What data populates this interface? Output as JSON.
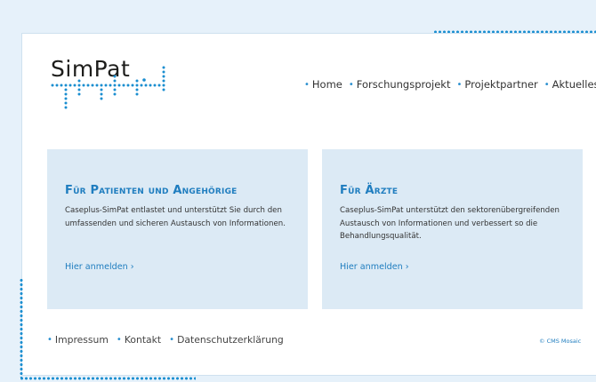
{
  "logo": {
    "text": "SimPat"
  },
  "nav": {
    "items": [
      {
        "label": "Home"
      },
      {
        "label": "Forschungsprojekt"
      },
      {
        "label": "Projektpartner"
      },
      {
        "label": "Aktuelles"
      }
    ]
  },
  "cards": {
    "patients": {
      "title": "Für Patienten und Angehörige",
      "text": "Caseplus-SimPat entlastet und unterstützt Sie durch den umfassenden und sicheren Austausch von Informationen.",
      "link": "Hier anmelden ›"
    },
    "doctors": {
      "title": "Für Ärzte",
      "text": "Caseplus-SimPat  unterstützt den sektorenübergreifenden Austausch von Informationen und verbessert so die Behandlungsqualität.",
      "link": "Hier anmelden ›"
    }
  },
  "footer": {
    "links": [
      {
        "label": "Impressum"
      },
      {
        "label": "Kontakt"
      },
      {
        "label": "Datenschutzerklärung"
      }
    ],
    "credit": "© CMS Mosaic"
  },
  "colors": {
    "accent": "#1f7dbf",
    "dots": "#1a8ed0",
    "background": "#e6f1fa",
    "card": "#dceaf5"
  }
}
